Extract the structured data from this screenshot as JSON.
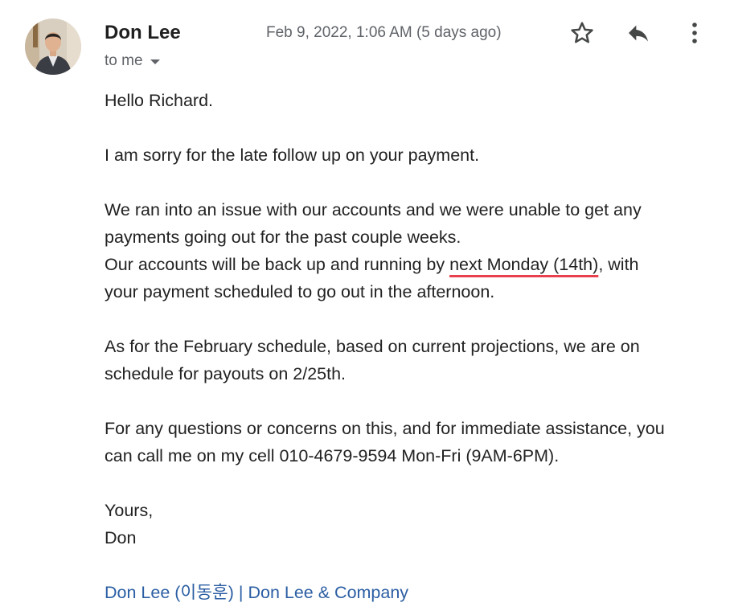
{
  "sender": {
    "name": "Don Lee",
    "avatar_icon": "person-photo"
  },
  "recipient_label": "to me",
  "date": "Feb 9, 2022, 1:06 AM (5 days ago)",
  "actions": {
    "star_icon": "star-icon",
    "reply_icon": "reply-icon",
    "more_icon": "more-vertical-icon"
  },
  "body": {
    "greeting": "Hello Richard.",
    "p1": "I am sorry for the late follow up on your payment.",
    "p2_line1": "We ran into an issue with our accounts and we were unable to get any",
    "p2_line2": "payments going out for the past couple weeks.",
    "p2_line3_before": "Our accounts will be back up and running by ",
    "p2_line3_highlight": "next Monday (14th)",
    "p2_line3_after": ", with",
    "p2_line4": "your payment scheduled to go out in the afternoon.",
    "p3_line1": "As for the February schedule, based on current projections, we are on",
    "p3_line2": "schedule for payouts on 2/25th.",
    "p4_line1": "For any questions or concerns on this, and for immediate assistance, you",
    "p4_line2": "can call me on my cell 010-4679-9594 Mon-Fri (9AM-6PM).",
    "closing": "Yours,",
    "sign": "Don"
  },
  "signature": {
    "name_link": "Don Lee (이동훈)",
    "separator": " | ",
    "company_link": "Don Lee & Company"
  },
  "colors": {
    "link": "#2b5ea3",
    "underline": "#e8404e",
    "secondary_text": "#5f6368"
  }
}
